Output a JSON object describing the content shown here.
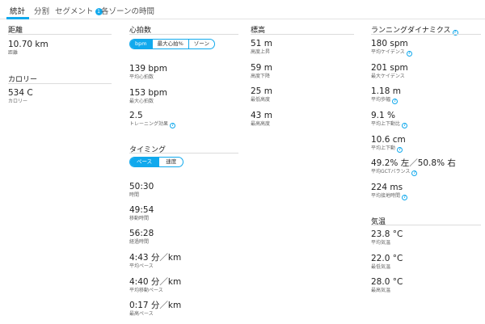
{
  "tabs": [
    "統計",
    "分割",
    "セグメント",
    "各ゾーンの時間"
  ],
  "segment_badge": "1",
  "info_glyph": "?",
  "distance": {
    "title": "距離",
    "value": "10.70 km",
    "label": "距離"
  },
  "calories": {
    "title": "カロリー",
    "value": "534 C",
    "label": "カロリー"
  },
  "heart_rate": {
    "title": "心拍数",
    "toggle": [
      "bpm",
      "最大心拍%",
      "ゾーン"
    ],
    "metrics": [
      {
        "value": "139 bpm",
        "label": "平均心拍数"
      },
      {
        "value": "153 bpm",
        "label": "最大心拍数"
      },
      {
        "value": "2.5",
        "label": "トレーニング効果"
      }
    ]
  },
  "timing": {
    "title": "タイミング",
    "toggle": [
      "ペース",
      "速度"
    ],
    "metrics": [
      {
        "value": "50:30",
        "label": "時間"
      },
      {
        "value": "49:54",
        "label": "移動時間"
      },
      {
        "value": "56:28",
        "label": "経過時間"
      },
      {
        "value": "4:43 分／km",
        "label": "平均ペース"
      },
      {
        "value": "4:40 分／km",
        "label": "平均移動ペース"
      },
      {
        "value": "0:17 分／km",
        "label": "最高ペース"
      }
    ]
  },
  "elevation": {
    "title": "標高",
    "metrics": [
      {
        "value": "51 m",
        "label": "高度上昇"
      },
      {
        "value": "59 m",
        "label": "高度下降"
      },
      {
        "value": "25 m",
        "label": "最低高度"
      },
      {
        "value": "43 m",
        "label": "最高高度"
      }
    ]
  },
  "running_dynamics": {
    "title": "ランニングダイナミクス",
    "metrics": [
      {
        "value": "180 spm",
        "label": "平均ケイデンス"
      },
      {
        "value": "201 spm",
        "label": "最大ケイデンス"
      },
      {
        "value": "1.18 m",
        "label": "平均歩幅"
      },
      {
        "value": "9.1 %",
        "label": "平均上下動比"
      },
      {
        "value": "10.6 cm",
        "label": "平均上下動"
      },
      {
        "value": "49.2% 左／50.8% 右",
        "label": "平均GCTバランス"
      },
      {
        "value": "224 ms",
        "label": "平均接地時間"
      }
    ]
  },
  "temperature": {
    "title": "気温",
    "metrics": [
      {
        "value": "23.8 °C",
        "label": "平均気温"
      },
      {
        "value": "22.0 °C",
        "label": "最低気温"
      },
      {
        "value": "28.0 °C",
        "label": "最高気温"
      }
    ]
  }
}
